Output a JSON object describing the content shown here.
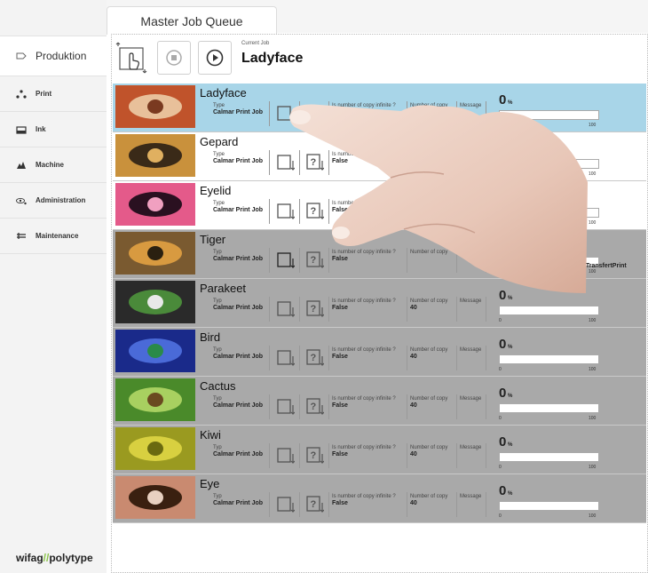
{
  "tab": {
    "label": "Master Job Queue"
  },
  "sidebar": {
    "main_label": "Produktion",
    "items": [
      {
        "label": "Print",
        "icon": "dots-icon"
      },
      {
        "label": "Ink",
        "icon": "ink-icon"
      },
      {
        "label": "Machine",
        "icon": "machine-icon"
      },
      {
        "label": "Administration",
        "icon": "eye-icon"
      },
      {
        "label": "Maintenance",
        "icon": "maintenance-icon"
      }
    ],
    "logo_left": "wifag",
    "logo_sep": "//",
    "logo_right": "polytype"
  },
  "current_job": {
    "label": "Current Job",
    "name": "Ladyface"
  },
  "colors": {
    "selected_row": "#a8d5e8",
    "dim_row": "#a9a9a9",
    "progress": "#4a90c2",
    "accent_green": "#8bc34a"
  },
  "labels": {
    "type": "Type",
    "typ": "Typ",
    "job_type": "Calmar Print Job",
    "infinite": "Is number of copy infinite ?",
    "number": "Number of copy",
    "message": "Message",
    "pct_unit": "%",
    "min": "0",
    "max": "100"
  },
  "jobs": [
    {
      "name": "Ladyface",
      "type_label": "Type",
      "infinite": "False",
      "copies": "",
      "percent": "0",
      "progress": 0
    },
    {
      "name": "Gepard",
      "type_label": "Type",
      "infinite": "False",
      "copies": "",
      "percent": "",
      "progress": 0
    },
    {
      "name": "Eyelid",
      "type_label": "Type",
      "infinite": "False",
      "copies": "",
      "percent": "",
      "progress": 0
    },
    {
      "name": "Tiger",
      "type_label": "Typ",
      "infinite": "False",
      "copies": "",
      "percent": "",
      "progress": 0,
      "message_text": "marTransfertPrint"
    },
    {
      "name": "Parakeet",
      "type_label": "Typ",
      "infinite": "False",
      "copies": "40",
      "percent": "0",
      "progress": 0
    },
    {
      "name": "Bird",
      "type_label": "Typ",
      "infinite": "False",
      "copies": "40",
      "percent": "0",
      "progress": 0
    },
    {
      "name": "Cactus",
      "type_label": "Typ",
      "infinite": "False",
      "copies": "40",
      "percent": "0",
      "progress": 0
    },
    {
      "name": "Kiwi",
      "type_label": "Typ",
      "infinite": "False",
      "copies": "40",
      "percent": "0",
      "progress": 0
    },
    {
      "name": "Eye",
      "type_label": "Typ",
      "infinite": "False",
      "copies": "40",
      "percent": "0",
      "progress": 0
    }
  ]
}
